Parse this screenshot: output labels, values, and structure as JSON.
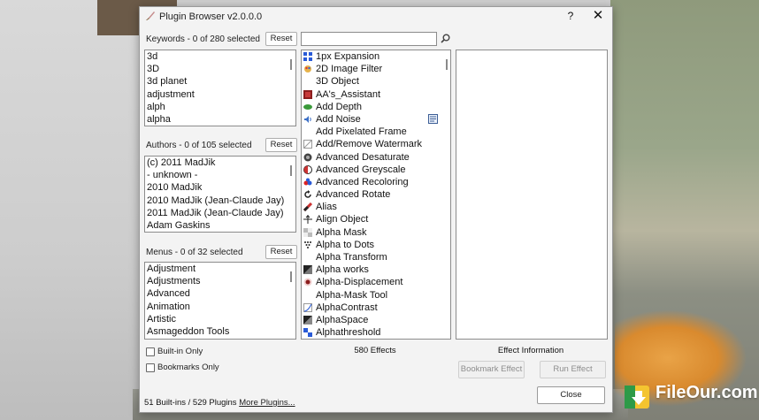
{
  "window": {
    "title": "Plugin Browser v2.0.0.0",
    "help": "?",
    "close": "✕"
  },
  "keywords": {
    "label": "Keywords  -  0 of 280 selected",
    "reset": "Reset",
    "items": [
      "3d",
      "3D",
      "3d planet",
      "adjustment",
      "alph",
      "alpha"
    ]
  },
  "authors": {
    "label": "Authors  -  0 of 105 selected",
    "reset": "Reset",
    "items": [
      "(c) 2011 MadJik",
      "- unknown -",
      "2010 MadJik",
      "2010 MadJik (Jean-Claude Jay)",
      "2011 MadJik (Jean-Claude Jay)",
      "Adam Gaskins"
    ]
  },
  "menus": {
    "label": "Menus  -  0 of 32 selected",
    "reset": "Reset",
    "items": [
      "Adjustment",
      "Adjustments",
      "Advanced",
      "Animation",
      "Artistic",
      "Asmageddon Tools"
    ]
  },
  "search": {
    "value": ""
  },
  "effects": [
    {
      "label": "1px Expansion",
      "icon": "grid-icon"
    },
    {
      "label": "2D Image Filter",
      "icon": "paint-icon"
    },
    {
      "label": "3D Object",
      "icon": ""
    },
    {
      "label": "AA's_Assistant",
      "icon": "red-square-icon"
    },
    {
      "label": "Add Depth",
      "icon": "green-disc-icon"
    },
    {
      "label": "Add Noise",
      "icon": "speaker-icon"
    },
    {
      "label": "Add Pixelated Frame",
      "icon": ""
    },
    {
      "label": "Add/Remove Watermark",
      "icon": "watermark-icon"
    },
    {
      "label": "Advanced Desaturate",
      "icon": "camera-icon"
    },
    {
      "label": "Advanced Greyscale",
      "icon": "halfcircle-icon"
    },
    {
      "label": "Advanced Recoloring",
      "icon": "rgb-dots-icon"
    },
    {
      "label": "Advanced Rotate",
      "icon": "rotate-icon"
    },
    {
      "label": "Alias",
      "icon": "diagonal-icon"
    },
    {
      "label": "Align Object",
      "icon": "align-icon"
    },
    {
      "label": "Alpha Mask",
      "icon": "checker-icon"
    },
    {
      "label": "Alpha to Dots",
      "icon": "dots-icon"
    },
    {
      "label": "Alpha Transform",
      "icon": ""
    },
    {
      "label": "Alpha works",
      "icon": "dark-square-icon"
    },
    {
      "label": "Alpha-Displacement",
      "icon": "blur-dot-icon"
    },
    {
      "label": "Alpha-Mask Tool",
      "icon": ""
    },
    {
      "label": "AlphaContrast",
      "icon": "curve-icon"
    },
    {
      "label": "AlphaSpace",
      "icon": "black-triangle-icon"
    },
    {
      "label": "Alphathreshold",
      "icon": "checker-blue-icon"
    }
  ],
  "effects_count": "580 Effects",
  "effect_info": {
    "label": "Effect Information"
  },
  "options": {
    "builtin_only": "Built-in Only",
    "bookmarks_only": "Bookmarks Only"
  },
  "buttons": {
    "bookmark": "Bookmark Effect",
    "run": "Run  Effect",
    "close": "Close"
  },
  "status": {
    "text": "51 Built-ins / 529 Plugins",
    "link": "More Plugins..."
  },
  "watermark": {
    "text": "FileOur.com"
  }
}
